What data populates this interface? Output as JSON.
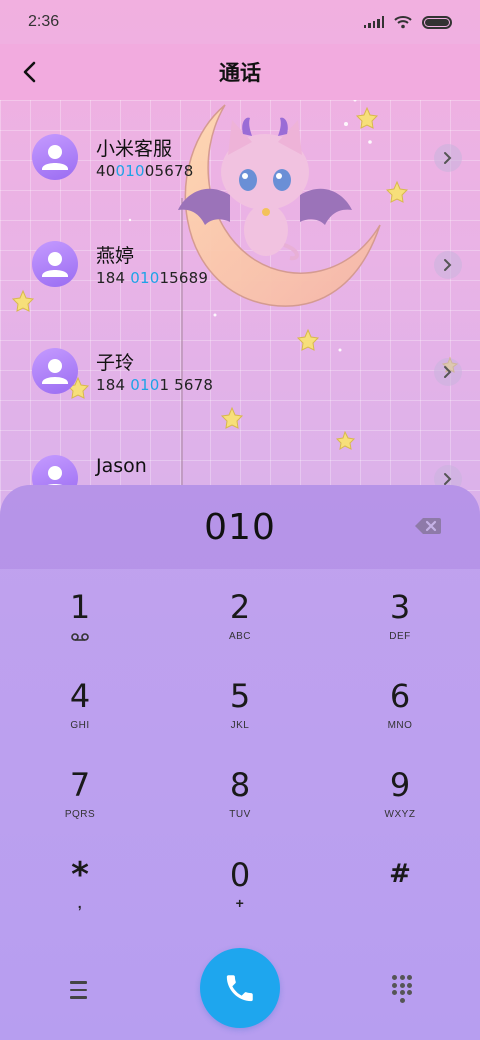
{
  "status_bar": {
    "time": "2:36"
  },
  "header": {
    "title": "通话"
  },
  "contacts": [
    {
      "name": "小米客服",
      "number_pre": "40",
      "number_match": "010",
      "number_post": "05678"
    },
    {
      "name": "燕婷",
      "number_pre": "184 ",
      "number_match": "010",
      "number_post": "15689"
    },
    {
      "name": "子玲",
      "number_pre": "184 ",
      "number_match": "010",
      "number_post": "1 5678"
    },
    {
      "name": "Jason",
      "number_pre": "",
      "number_match": "",
      "number_post": ""
    }
  ],
  "dialer": {
    "input": "010",
    "keys": [
      {
        "digit": "1",
        "letters": ""
      },
      {
        "digit": "2",
        "letters": "ABC"
      },
      {
        "digit": "3",
        "letters": "DEF"
      },
      {
        "digit": "4",
        "letters": "GHI"
      },
      {
        "digit": "5",
        "letters": "JKL"
      },
      {
        "digit": "6",
        "letters": "MNO"
      },
      {
        "digit": "7",
        "letters": "PQRS"
      },
      {
        "digit": "8",
        "letters": "TUV"
      },
      {
        "digit": "9",
        "letters": "WXYZ"
      },
      {
        "digit": "*",
        "letters": ","
      },
      {
        "digit": "0",
        "letters": "+"
      },
      {
        "digit": "#",
        "letters": ""
      }
    ]
  },
  "icons": {
    "back": "chevron-left-icon",
    "voicemail": "voicemail-icon",
    "backspace": "backspace-icon",
    "menu": "menu-icon",
    "call": "phone-icon",
    "keypad": "dialpad-icon"
  },
  "colors": {
    "match_highlight": "#1fa3e6",
    "call_button": "#1ea6ee",
    "header_bg": "#f2aade",
    "dialer_bg": "#b79ef0"
  }
}
